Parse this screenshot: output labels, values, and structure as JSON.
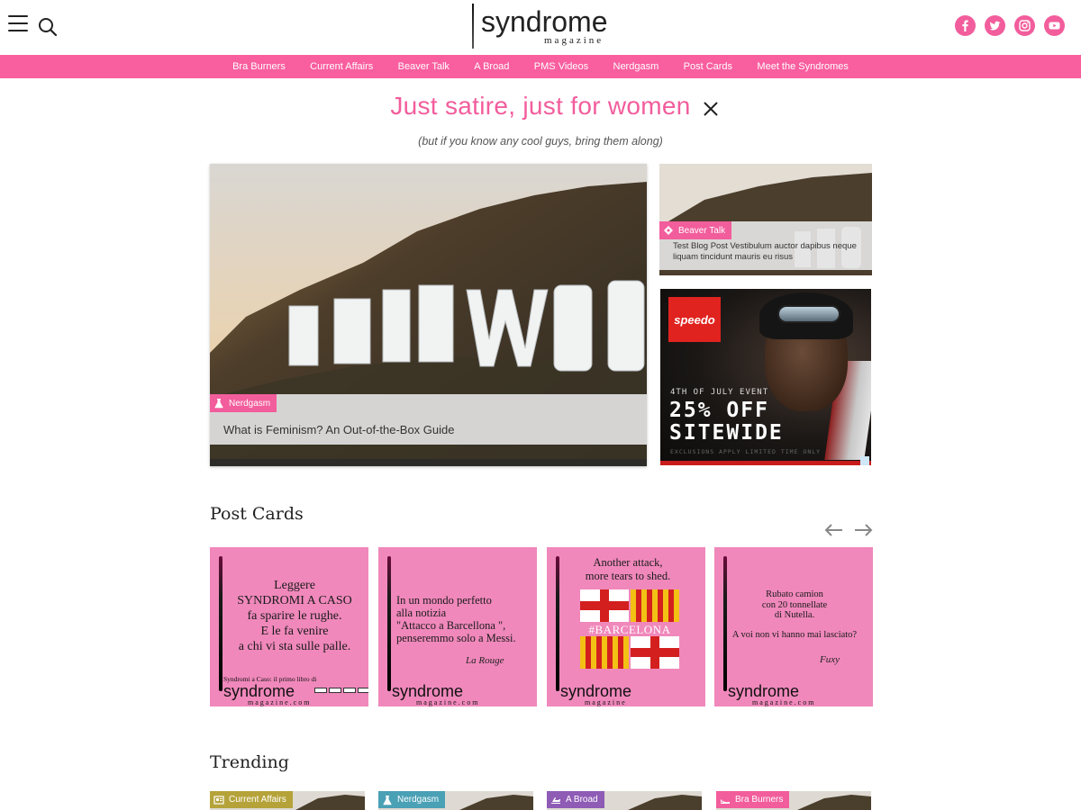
{
  "brand": {
    "name": "syndrome",
    "sub": "magazine"
  },
  "nav": [
    "Bra Burners",
    "Current Affairs",
    "Beaver Talk",
    "A Broad",
    "PMS Videos",
    "Nerdgasm",
    "Post Cards",
    "Meet the Syndromes"
  ],
  "tagline": {
    "title": "Just satire, just for women",
    "subtitle": "(but if you know any cool guys, bring them along)"
  },
  "colors": {
    "accent": "#f25d9c",
    "nav_bg": "#f95e9f"
  },
  "icons": [
    "menu-icon",
    "search-icon",
    "facebook-icon",
    "twitter-icon",
    "instagram-icon",
    "youtube-icon",
    "close-icon",
    "arrow-left-icon",
    "arrow-right-icon",
    "flask-icon",
    "diamond-icon"
  ],
  "hero": {
    "category": "Nerdgasm",
    "title": "What is Feminism? An Out-of-the-Box Guide",
    "image_text": "HOLLYWOO"
  },
  "side_post": {
    "category": "Beaver Talk",
    "title": "Test Blog Post Vestibulum auctor dapibus neque liquam tincidunt mauris eu risus"
  },
  "ad": {
    "logo": "speedo",
    "event": "4TH OF JULY EVENT",
    "headline1": "25% OFF",
    "headline2": "SITEWIDE",
    "fine": "EXCLUSIONS APPLY    LIMITED TIME ONLY"
  },
  "post_cards": {
    "title": "Post Cards",
    "cards": [
      {
        "lines": [
          "Leggere",
          "SYNDROMI A CASO",
          "fa sparire le rughe.",
          "E le fa venire",
          "a chi vi sta sulle palle."
        ],
        "sign": "",
        "footer": "Syndromi a Caso: il primo libro di",
        "brand": "syndrome",
        "brand_sub": "magazine.com"
      },
      {
        "lines": [
          "In un mondo perfetto",
          "alla notizia",
          "\"Attacco a Barcellona \",",
          "penseremmo solo a Messi."
        ],
        "sign": "La Rouge",
        "footer": "",
        "brand": "syndrome",
        "brand_sub": "magazine.com"
      },
      {
        "lines": [
          "Another attack,",
          "more tears to shed."
        ],
        "sign": "",
        "footer": "",
        "flag_text": "#BARCELONA",
        "brand": "syndrome",
        "brand_sub": "magazine"
      },
      {
        "lines": [
          "Rubato camion",
          "con 20 tonnellate",
          "di Nutella.",
          "",
          "A voi non vi hanno mai lasciato?"
        ],
        "sign": "Fuxy",
        "footer": "",
        "brand": "syndrome",
        "brand_sub": "magazine.com"
      }
    ]
  },
  "trending": {
    "title": "Trending",
    "items": [
      {
        "category": "Current Affairs",
        "color": "#b5a33a"
      },
      {
        "category": "Nerdgasm",
        "color": "#4aa0b5"
      },
      {
        "category": "A Broad",
        "color": "#8e5bb5"
      },
      {
        "category": "Bra Burners",
        "color": "#f25d9c"
      }
    ]
  }
}
